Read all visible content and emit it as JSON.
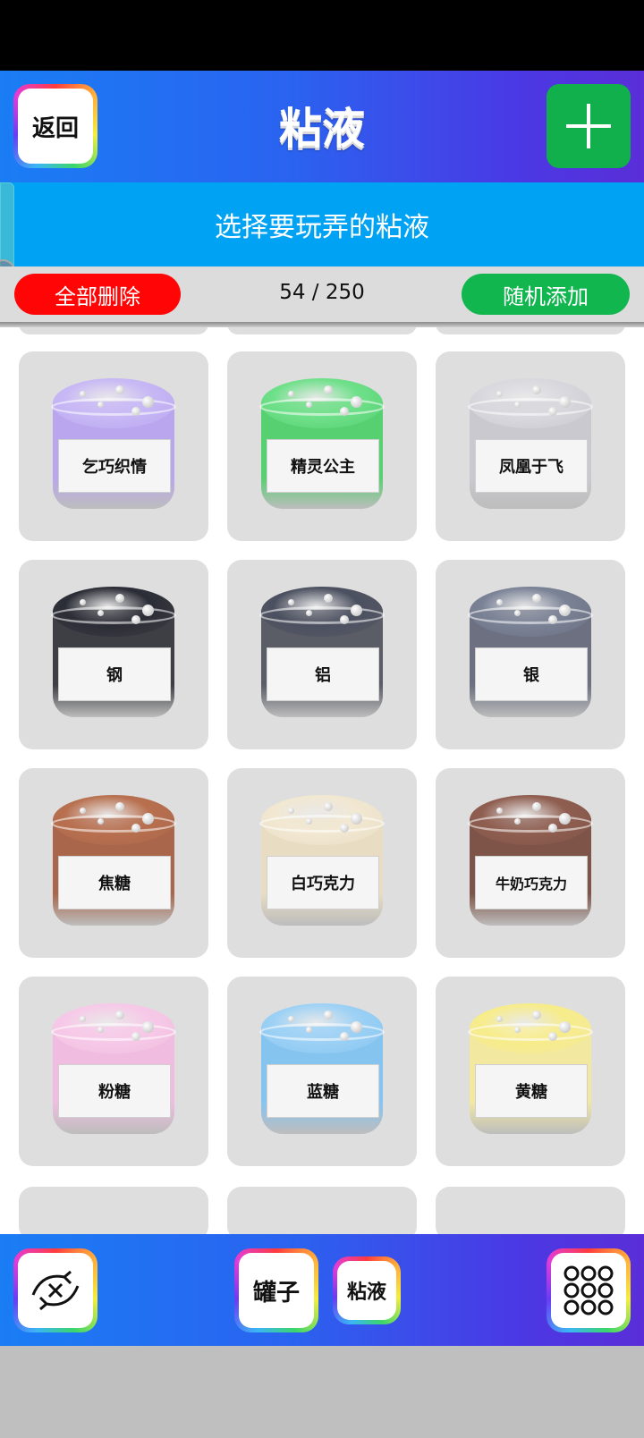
{
  "header": {
    "back_label": "返回",
    "title": "粘液",
    "plus_icon": "plus-icon"
  },
  "subheader": {
    "text": "选择要玩弄的粘液"
  },
  "toolbar": {
    "delete_all": "全部删除",
    "counter": "54 / 250",
    "random_add": "随机添加"
  },
  "slimes": [
    {
      "name": "乞巧织情",
      "color": "#b9a6ef",
      "lid": "#c8b8f5"
    },
    {
      "name": "精灵公主",
      "color": "#56d070",
      "lid": "#6fe08a"
    },
    {
      "name": "凤凰于飞",
      "color": "#c9c9cf",
      "lid": "#d8d8de"
    },
    {
      "name": "钢",
      "color": "#3e3f45",
      "lid": "#2b2d36"
    },
    {
      "name": "铝",
      "color": "#5a5c66",
      "lid": "#4b5060"
    },
    {
      "name": "银",
      "color": "#6c7080",
      "lid": "#7a8296"
    },
    {
      "name": "焦糖",
      "color": "#a9664b",
      "lid": "#b8704f"
    },
    {
      "name": "白巧克力",
      "color": "#e8dcc2",
      "lid": "#f2e8d2"
    },
    {
      "name": "牛奶巧克力",
      "color": "#7f5448",
      "lid": "#8f5e50"
    },
    {
      "name": "粉糖",
      "color": "#f0bde0",
      "lid": "#f7c9e8"
    },
    {
      "name": "蓝糖",
      "color": "#86c4f0",
      "lid": "#9dd1f5"
    },
    {
      "name": "黄糖",
      "color": "#f3e8a0",
      "lid": "#f7ec8a"
    }
  ],
  "bottom": {
    "reset_icon": "cycle-reset-icon",
    "jar_label": "罐子",
    "slime_label": "粘液",
    "grid_icon": "grid-dots-icon"
  }
}
